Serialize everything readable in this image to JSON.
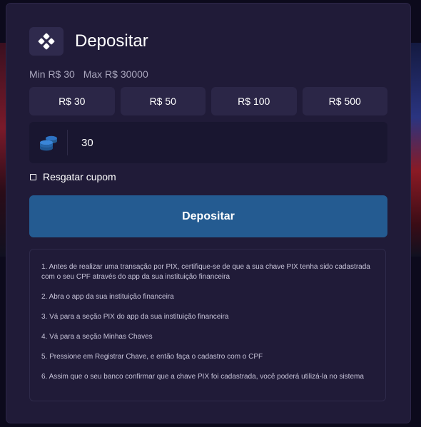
{
  "modal": {
    "title": "Depositar",
    "limits": {
      "min": "Min R$ 30",
      "max": "Max R$ 30000"
    },
    "amount_options": [
      "R$ 30",
      "R$ 50",
      "R$ 100",
      "R$ 500"
    ],
    "amount_input": {
      "value": "30",
      "icon": "coins-icon"
    },
    "coupon_label": "Resgatar cupom",
    "submit_label": "Depositar",
    "instructions": [
      "1. Antes de realizar uma transação por PIX, certifique-se de que a sua chave PIX tenha sido cadastrada com o seu CPF através do app da sua instituição financeira",
      "2. Abra o app da sua instituição financeira",
      "3. Vá para a seção PIX do app da sua instituição financeira",
      "4. Vá para a seção Minhas Chaves",
      "5. Pressione em Registrar Chave, e então faça o cadastro com o CPF",
      "6. Assim que o seu banco confirmar que a chave PIX foi cadastrada, você poderá utilizá-la no sistema"
    ]
  },
  "colors": {
    "modal_bg": "#201b38",
    "button_bg": "#2b2647",
    "primary": "#245b91",
    "coin": "#2e73c4"
  }
}
